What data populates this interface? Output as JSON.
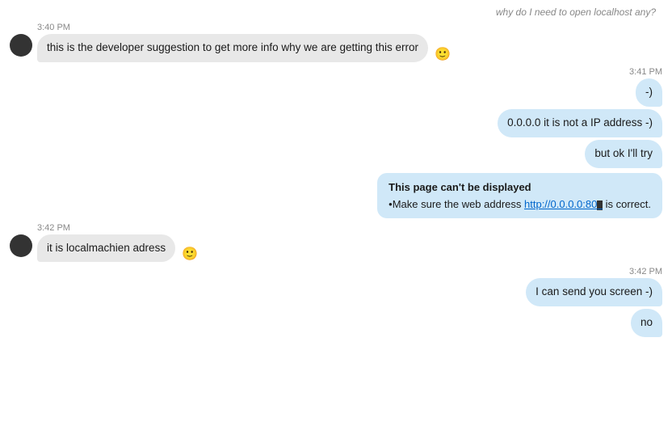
{
  "chat": {
    "topPartialMessage": "why do I need to open localhost any?",
    "messages": [
      {
        "id": "msg1",
        "side": "left",
        "timestamp": "3:40 PM",
        "text": "this is the developer suggestion to get more info why we are getting this error",
        "hasEmoji": true,
        "emoji": "🙂"
      },
      {
        "id": "msg2",
        "side": "right",
        "timestamp": "3:41 PM",
        "bubbles": [
          "-)",
          "0.0.0.0 it is not a IP address -)",
          "but ok I'll try"
        ]
      },
      {
        "id": "msg3",
        "side": "right",
        "isScreenshot": true,
        "screenshotTitle": "This page can't be displayed",
        "screenshotBullet": "•Make sure the web address ",
        "screenshotLink": "http://0.0.0.0:80",
        "screenshotLinkSuffix": " is correct."
      },
      {
        "id": "msg4",
        "side": "left",
        "timestamp": "3:42 PM",
        "text": "it is localmachien adress",
        "hasEmoji": true,
        "emoji": "🙂"
      },
      {
        "id": "msg5",
        "side": "right",
        "timestamp": "3:42 PM",
        "bubbles": [
          "I can send you screen -)",
          "no"
        ]
      }
    ]
  }
}
